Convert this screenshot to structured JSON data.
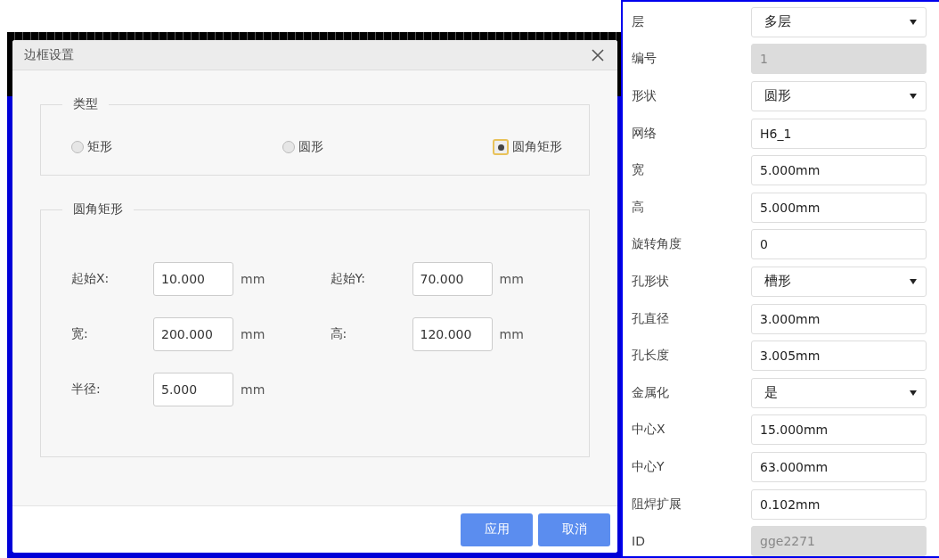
{
  "dialog": {
    "title": "边框设置",
    "type_group": {
      "legend": "类型",
      "options": [
        {
          "label": "矩形",
          "selected": false
        },
        {
          "label": "圆形",
          "selected": false
        },
        {
          "label": "圆角矩形",
          "selected": true
        }
      ]
    },
    "shape_group": {
      "legend": "圆角矩形",
      "fields": [
        {
          "label": "起始X:",
          "value": "10.000",
          "unit": "mm"
        },
        {
          "label": "起始Y:",
          "value": "70.000",
          "unit": "mm"
        },
        {
          "label": "宽:",
          "value": "200.000",
          "unit": "mm"
        },
        {
          "label": "高:",
          "value": "120.000",
          "unit": "mm"
        },
        {
          "label": "半径:",
          "value": "5.000",
          "unit": "mm"
        }
      ]
    },
    "buttons": [
      "应用",
      "取消"
    ]
  },
  "properties": [
    {
      "label": "层",
      "kind": "select",
      "value": "多层",
      "disabled": false
    },
    {
      "label": "编号",
      "kind": "text",
      "value": "1",
      "disabled": true
    },
    {
      "label": "形状",
      "kind": "select",
      "value": "圆形",
      "disabled": false
    },
    {
      "label": "网络",
      "kind": "text",
      "value": "H6_1",
      "disabled": false
    },
    {
      "label": "宽",
      "kind": "text",
      "value": "5.000mm",
      "disabled": false
    },
    {
      "label": "高",
      "kind": "text",
      "value": "5.000mm",
      "disabled": false
    },
    {
      "label": "旋转角度",
      "kind": "text",
      "value": "0",
      "disabled": false
    },
    {
      "label": "孔形状",
      "kind": "select",
      "value": "槽形",
      "disabled": false
    },
    {
      "label": "孔直径",
      "kind": "text",
      "value": "3.000mm",
      "disabled": false
    },
    {
      "label": "孔长度",
      "kind": "text",
      "value": "3.005mm",
      "disabled": false
    },
    {
      "label": "金属化",
      "kind": "select",
      "value": "是",
      "disabled": false
    },
    {
      "label": "中心X",
      "kind": "text",
      "value": "15.000mm",
      "disabled": false
    },
    {
      "label": "中心Y",
      "kind": "text",
      "value": "63.000mm",
      "disabled": false
    },
    {
      "label": "阻焊扩展",
      "kind": "text",
      "value": "0.102mm",
      "disabled": false
    },
    {
      "label": "ID",
      "kind": "text",
      "value": "gge2271",
      "disabled": true
    }
  ]
}
